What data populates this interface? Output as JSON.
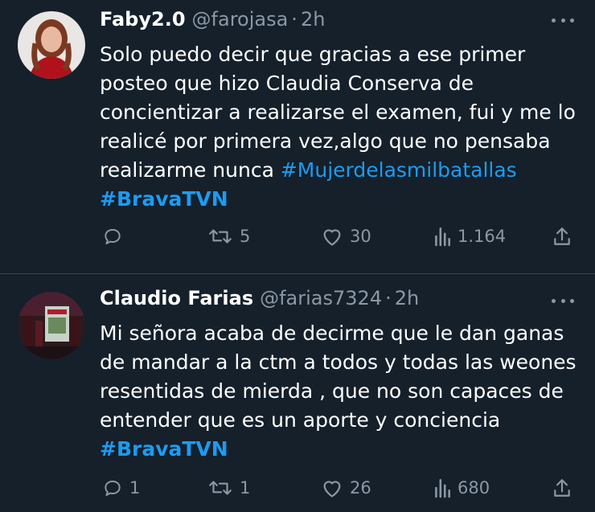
{
  "tweets": [
    {
      "author": "Faby2.0",
      "handle": "@farojasa",
      "dot": "·",
      "time": "2h",
      "body_text": "Solo puedo decir que gracias a ese primer posteo que hizo Claudia Conserva de concientizar a realizarse el examen, fui y me lo realicé por primera vez,algo que no pensaba realizarme nunca",
      "hashtag1": "#Mujerdelasmilbatallas",
      "hashtag2": "#BravaTVN",
      "replies": "",
      "retweets": "5",
      "likes": "30",
      "views": "1.164"
    },
    {
      "author": "Claudio Farias",
      "handle": "@farias7324",
      "dot": "·",
      "time": "2h",
      "body_text": "Mi señora acaba de decirme que le dan ganas de mandar a la ctm a todos y todas las weones resentidas  de mierda ,  que no son capaces de entender que es un aporte y conciencia",
      "hashtag1": "#BravaTVN",
      "replies": "1",
      "retweets": "1",
      "likes": "26",
      "views": "680"
    }
  ],
  "colors": {
    "background": "#15202b",
    "text": "#ffffff",
    "muted": "#8b98a5",
    "link": "#1d9bf0",
    "divider": "#38444d"
  },
  "icons": [
    "reply-icon",
    "retweet-icon",
    "like-icon",
    "views-icon",
    "share-icon",
    "more-icon"
  ]
}
